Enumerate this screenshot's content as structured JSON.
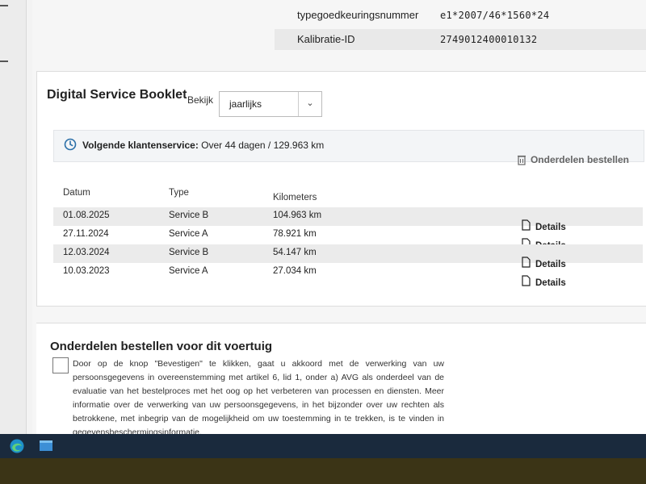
{
  "vehicle_info": [
    {
      "label": "typegoedkeuringsnummer",
      "value": "e1*2007/46*1560*24"
    },
    {
      "label": "Kalibratie-ID",
      "value": "2749012400010132"
    }
  ],
  "booklet": {
    "title": "Digital Service Booklet",
    "view_label": "Bekijk",
    "view_select": "jaarlijks",
    "notice_bold": "Volgende klantenservice:",
    "notice_text": " Over 44 dagen / 129.963 km",
    "order_parts": "Onderdelen bestellen",
    "columns": {
      "date": "Datum",
      "type": "Type",
      "km": "Kilometers"
    },
    "rows": [
      {
        "date": "01.08.2025",
        "type": "Service B",
        "km": "104.963 km",
        "details": "Details"
      },
      {
        "date": "27.11.2024",
        "type": "Service A",
        "km": "78.921 km",
        "details": "Details"
      },
      {
        "date": "12.03.2024",
        "type": "Service B",
        "km": "54.147 km",
        "details": "Details"
      },
      {
        "date": "10.03.2023",
        "type": "Service A",
        "km": "27.034 km",
        "details": "Details"
      }
    ]
  },
  "parts_section": {
    "title": "Onderdelen bestellen voor dit voertuig",
    "consent_text": "Door op de knop \"Bevestigen\" te klikken, gaat u akkoord met de verwerking van uw persoonsgegevens in overeenstemming met artikel 6, lid 1, onder a) AVG als onderdeel van de evaluatie van het bestelproces met het oog op het verbeteren van processen en diensten. Meer informatie over de verwerking van uw persoonsgegevens, in het bijzonder over uw rechten als betrokkene, met inbegrip van de mogelijkheid om uw toestemming in te trekken, is te vinden in ",
    "consent_link": "gegevensbeschermingsinformatie."
  },
  "taskbar": {
    "icons": [
      "edge-icon",
      "app-icon"
    ]
  },
  "colors": {
    "taskbar": "#1a2a3d",
    "accent": "#0a7bd8"
  }
}
